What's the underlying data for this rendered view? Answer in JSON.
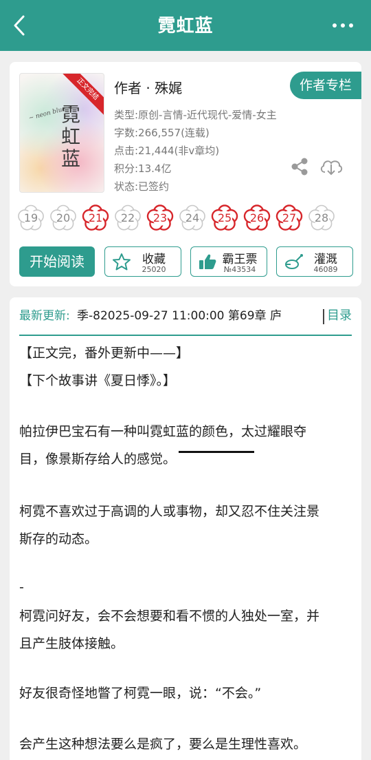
{
  "header": {
    "title": "霓虹蓝"
  },
  "book": {
    "cover_title": "霓虹蓝",
    "cover_ribbon": "正文完结",
    "author": "作者 · 殊娓",
    "author_column_label": "作者专栏",
    "type_line": "类型:原创-言情-近代现代-爱情-女主",
    "word_count_line": "字数:266,557(连载)",
    "clicks_line": "点击:21,444(非v章均)",
    "points_line": "积分:13.4亿",
    "status_line": "状态:已签约"
  },
  "flowers": [
    {
      "day": "19",
      "active": false
    },
    {
      "day": "20",
      "active": false
    },
    {
      "day": "21",
      "active": true
    },
    {
      "day": "22",
      "active": false
    },
    {
      "day": "23",
      "active": true
    },
    {
      "day": "24",
      "active": false
    },
    {
      "day": "25",
      "active": true
    },
    {
      "day": "26",
      "active": true
    },
    {
      "day": "27",
      "active": true
    },
    {
      "day": "28",
      "active": false
    }
  ],
  "colors": {
    "accent": "#2e9c8e",
    "flower_active": "#d7262b",
    "flower_inactive": "#c8c8c8"
  },
  "actions": {
    "start_reading": "开始阅读",
    "collect_label": "收藏",
    "collect_count": "25020",
    "ticket_label": "霸王票",
    "ticket_count": "№43534",
    "water_label": "灌溉",
    "water_count": "46089"
  },
  "latest_update": {
    "label": "最新更新:",
    "text": "季-82025-09-27 11:00:00   第69章 庐",
    "toc_label": "目录"
  },
  "synopsis": [
    "【正文完，番外更新中——】",
    "【下个故事讲《夏日悸》。】",
    "帕拉伊巴宝石有一种叫霓虹蓝的颜色，太过耀眼夺",
    "目，像景斯存给人的感觉。",
    "柯霓不喜欢过于高调的人或事物，却又忍不住关注景",
    "斯存的动态。",
    "-",
    "柯霓问好友，会不会想要和看不惯的人独处一室，并",
    "且产生肢体接触。",
    "好友很奇怪地瞥了柯霓一眼，说：“不会。”",
    "会产生这种想法要么是疯了，要么是生理性喜欢。"
  ],
  "icons": {
    "back": "chevron-left-icon",
    "more": "more-dots-icon",
    "share": "share-icon",
    "download": "cloud-download-icon",
    "collect": "star-icon",
    "ticket": "thumbs-up-icon",
    "water": "watering-can-icon"
  }
}
